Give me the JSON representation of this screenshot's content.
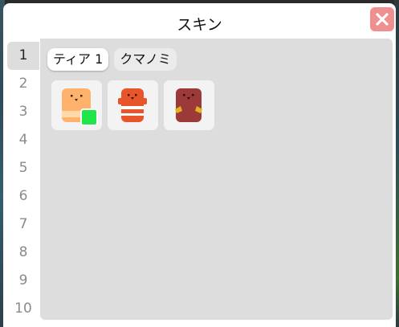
{
  "dialog": {
    "title": "スキン"
  },
  "sidebar": {
    "items": [
      "1",
      "2",
      "3",
      "4",
      "5",
      "6",
      "7",
      "8",
      "9",
      "10"
    ],
    "active_index": 0
  },
  "tabs": [
    {
      "label": "ティア 1",
      "active": true
    },
    {
      "label": "クマノミ",
      "active": false
    }
  ],
  "skins": [
    {
      "icon": "orange-bear-skin-icon",
      "equipped": true,
      "colors": {
        "main": "#ffb26b",
        "light": "#ffd9a8"
      }
    },
    {
      "icon": "clownfish-bear-skin-icon",
      "equipped": false,
      "colors": {
        "main": "#e8552a",
        "stripe": "#ffffff"
      }
    },
    {
      "icon": "dark-red-bear-skin-icon",
      "equipped": false,
      "colors": {
        "main": "#9c3a3a",
        "accent": "#e3b21f"
      }
    }
  ],
  "colors": {
    "close_bg": "#ef8f8f",
    "panel_bg": "#dddddd",
    "equipped_marker": "#21e64a"
  }
}
